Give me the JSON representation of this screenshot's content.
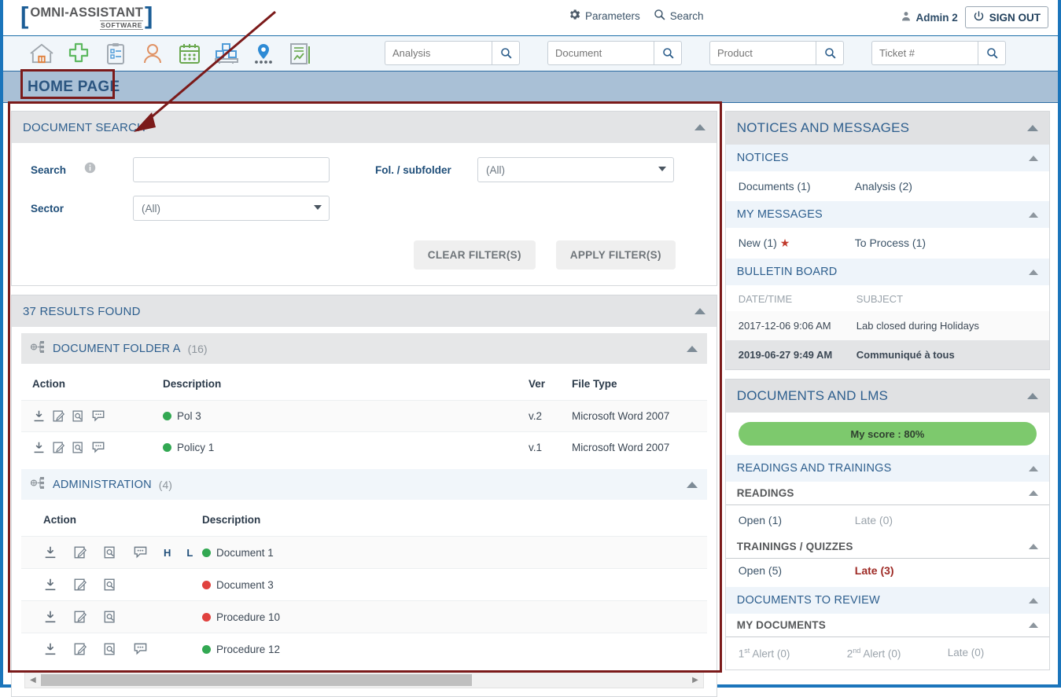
{
  "brand": {
    "bracket_left": "[",
    "bracket_right": "]",
    "name": "OMNI-ASSISTANT",
    "sub": "SOFTWARE"
  },
  "topbar": {
    "parameters_label": "Parameters",
    "search_label": "Search",
    "user_label": "Admin 2",
    "signout_label": "SIGN OUT"
  },
  "nav": {
    "icons": [
      "home-icon",
      "plus-cross-icon",
      "clipboard-checklist-icon",
      "person-icon",
      "calendar-icon",
      "pallet-boxes-icon",
      "location-pin-icon",
      "report-chart-icon"
    ]
  },
  "quick_search": {
    "analysis_placeholder": "Analysis",
    "document_placeholder": "Document",
    "product_placeholder": "Product",
    "ticket_placeholder": "Ticket #"
  },
  "page": {
    "title": "HOME PAGE"
  },
  "document_search": {
    "panel_title": "DOCUMENT SEARCH",
    "search_label": "Search",
    "search_value": "",
    "sector_label": "Sector",
    "sector_value": "(All)",
    "folder_label": "Fol. / subfolder",
    "folder_value": "(All)",
    "clear_label": "CLEAR FILTER(S)",
    "apply_label": "APPLY FILTER(S)"
  },
  "results": {
    "header": "37 RESULTS FOUND",
    "folder_a": {
      "name": "DOCUMENT FOLDER A",
      "count": "(16)",
      "columns": {
        "action": "Action",
        "description": "Description",
        "ver": "Ver",
        "file_type": "File Type"
      },
      "rows": [
        {
          "status": "green",
          "description": "Pol 3",
          "ver": "v.2",
          "file_type": "Microsoft Word 2007",
          "actions": [
            "download-icon",
            "edit-icon",
            "preview-icon",
            "comment-icon"
          ]
        },
        {
          "status": "green",
          "description": "Policy 1",
          "ver": "v.1",
          "file_type": "Microsoft Word 2007",
          "actions": [
            "download-icon",
            "edit-icon",
            "preview-icon",
            "comment-icon"
          ]
        }
      ]
    },
    "folder_admin": {
      "name": "ADMINISTRATION",
      "count": "(4)",
      "columns": {
        "action": "Action",
        "description": "Description"
      },
      "rows": [
        {
          "status": "green",
          "description": "Document 1",
          "actions": [
            "download-icon",
            "edit-icon",
            "preview-icon",
            "comment-icon"
          ],
          "h": "H",
          "l": "L"
        },
        {
          "status": "red",
          "description": "Document 3",
          "actions": [
            "download-icon",
            "edit-icon",
            "preview-icon"
          ],
          "h": "",
          "l": ""
        },
        {
          "status": "red",
          "description": "Procedure 10",
          "actions": [
            "download-icon",
            "edit-icon",
            "preview-icon"
          ],
          "h": "",
          "l": ""
        },
        {
          "status": "green",
          "description": "Procedure 12",
          "actions": [
            "download-icon",
            "edit-icon",
            "preview-icon",
            "comment-icon"
          ],
          "h": "",
          "l": ""
        }
      ]
    }
  },
  "notices_panel": {
    "title": "NOTICES AND MESSAGES",
    "notices": {
      "title": "NOTICES",
      "documents": "Documents (1)",
      "analysis": "Analysis (2)"
    },
    "my_messages": {
      "title": "MY MESSAGES",
      "new": "New (1)",
      "to_process": "To Process (1)"
    },
    "bulletin_board": {
      "title": "BULLETIN BOARD",
      "col_date": "DATE/TIME",
      "col_subject": "SUBJECT",
      "rows": [
        {
          "date": "2017-12-06 9:06 AM",
          "subject": "Lab closed during Holidays"
        },
        {
          "date": "2019-06-27 9:49 AM",
          "subject": "Communiqué à tous"
        }
      ]
    }
  },
  "lms_panel": {
    "title": "DOCUMENTS AND LMS",
    "score_label": "My score : 80%",
    "score_color": "#7dc96d",
    "readings_trainings": {
      "title": "READINGS AND TRAININGS"
    },
    "readings": {
      "title": "READINGS",
      "open": "Open (1)",
      "late": "Late (0)"
    },
    "trainings": {
      "title": "TRAININGS / QUIZZES",
      "open": "Open (5)",
      "late": "Late (3)"
    },
    "documents_review": {
      "title": "DOCUMENTS TO REVIEW"
    },
    "my_documents": {
      "title": "MY DOCUMENTS",
      "alert1_pre": "1",
      "alert1_sup": "st",
      "alert1_post": " Alert (0)",
      "alert2_pre": "2",
      "alert2_sup": "nd",
      "alert2_post": " Alert (0)",
      "late": "Late (0)"
    }
  },
  "annotation": {
    "color": "#7b1a1a"
  },
  "colors": {
    "accent_blue": "#1b75bb",
    "title_blue": "#2e5f8e",
    "page_bar": "#a9c0d6",
    "green_status": "#32a852",
    "red_status": "#e0413e",
    "late_red": "#9e2a25"
  }
}
